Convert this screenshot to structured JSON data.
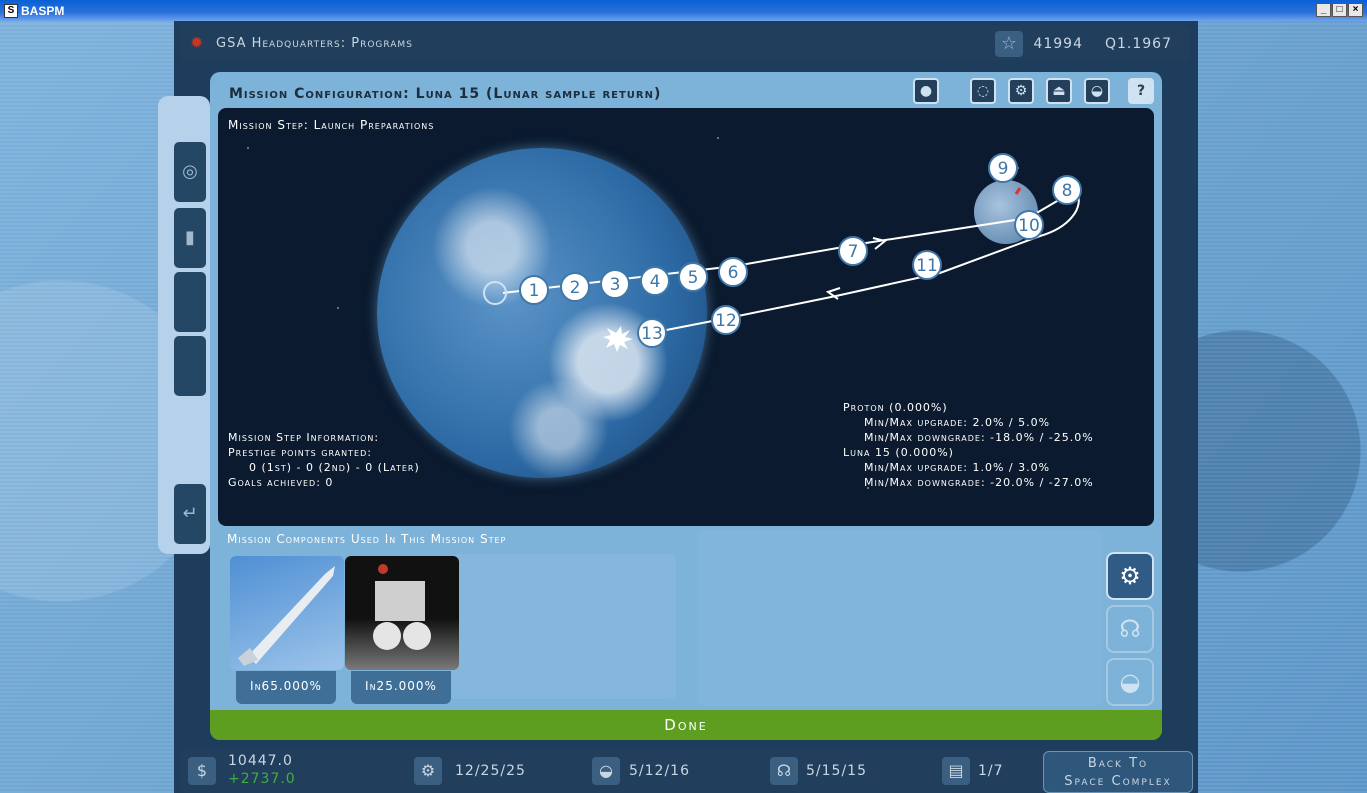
{
  "window": {
    "title": "BASPM",
    "buttons": [
      "_",
      "□",
      "×"
    ]
  },
  "header": {
    "title": "GSA Headquarters: Programs",
    "prestige": "41994",
    "date": "Q1.1967"
  },
  "panel": {
    "title": "Mission Configuration: Luna 15 (Lunar sample return)",
    "toolbar_icons": [
      "circle-icon",
      "orbit-icon",
      "gear-icon",
      "launchpad-icon",
      "helmet-icon",
      "help-icon"
    ],
    "help_label": "?"
  },
  "map": {
    "step_title": "Mission Step: Launch Preparations",
    "nodes": [
      "1",
      "2",
      "3",
      "4",
      "5",
      "6",
      "7",
      "8",
      "9",
      "10",
      "11",
      "12",
      "13"
    ]
  },
  "step_info": {
    "heading": "Mission Step Information:",
    "prestige_label": "Prestige points granted:",
    "prestige_values": "0 (1st) - 0 (2nd) - 0 (Later)",
    "goals": "Goals achieved: 0"
  },
  "components_info": {
    "c1_name": "Proton (0.000%)",
    "c1_up": "Min/Max upgrade: 2.0% / 5.0%",
    "c1_down": "Min/Max downgrade: -18.0% / -25.0%",
    "c2_name": "Luna 15 (0.000%)",
    "c2_up": "Min/Max upgrade: 1.0% / 3.0%",
    "c2_down": "Min/Max downgrade: -20.0% / -27.0%"
  },
  "components": {
    "heading": "Mission Components Used In This Mission Step",
    "items": [
      {
        "label": "In65.000%"
      },
      {
        "label": "In25.000%"
      }
    ]
  },
  "done_label": "Done",
  "bottom": {
    "funds": "10447.0",
    "funds_delta": "+2737.0",
    "hardware": "12/25/25",
    "astronauts": "5/12/16",
    "crew": "5/15/15",
    "programs": "1/7",
    "back_line1": "Back To",
    "back_line2": "Space Complex"
  }
}
